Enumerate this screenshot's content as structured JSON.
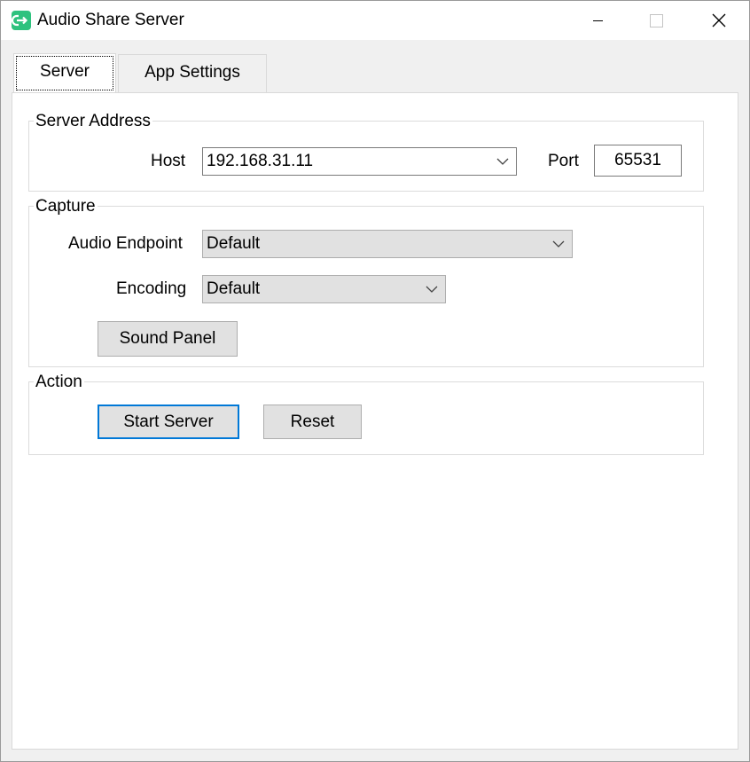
{
  "window": {
    "title": "Audio Share Server",
    "app_icon": "audio-share-icon",
    "controls": [
      "minimize-icon",
      "maximize-icon",
      "close-icon"
    ]
  },
  "tabs": [
    {
      "label": "Server",
      "selected": true
    },
    {
      "label": "App Settings",
      "selected": false
    }
  ],
  "server_address": {
    "title": "Server Address",
    "host_label": "Host",
    "host_value": "192.168.31.11",
    "port_label": "Port",
    "port_value": "65531"
  },
  "capture": {
    "title": "Capture",
    "endpoint_label": "Audio Endpoint",
    "endpoint_value": "Default",
    "encoding_label": "Encoding",
    "encoding_value": "Default",
    "sound_panel_label": "Sound Panel"
  },
  "action": {
    "title": "Action",
    "start_label": "Start Server",
    "reset_label": "Reset"
  },
  "colors": {
    "accent": "#0078d7",
    "app_icon": "#2ec27e",
    "window_bg": "#f0f0f0",
    "page_bg": "#ffffff"
  }
}
